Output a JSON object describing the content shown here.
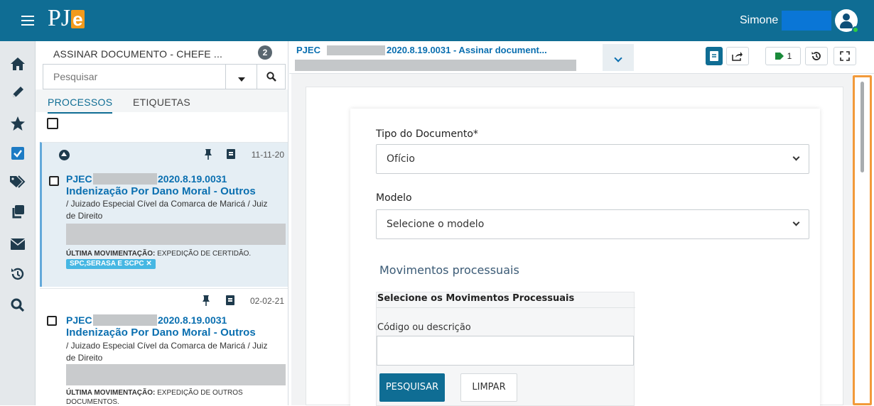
{
  "app": {
    "logo": "PJ",
    "logo_e": "e"
  },
  "user": {
    "name": "Simone"
  },
  "sidebar": {
    "icons": [
      "home-icon",
      "pencil-icon",
      "star-icon",
      "checkbox-icon",
      "tags-icon",
      "copy-icon",
      "envelope-icon",
      "history-icon",
      "search-icon"
    ]
  },
  "tasks": {
    "title": "ASSINAR DOCUMENTO - CHEFE ...",
    "count": "2",
    "search_placeholder": "Pesquisar",
    "tabs": [
      "PROCESSOS",
      "ETIQUETAS"
    ]
  },
  "cards": [
    {
      "date": "11-11-20",
      "num_prefix": "PJEC",
      "num_suffix": "2020.8.19.0031",
      "classe": "Indenização Por Dano Moral - Outros",
      "orgao": "/ Juizado Especial Cível da Comarca de Maricá / Juiz de Direito",
      "mov_label": "ÚLTIMA MOVIMENTAÇÃO:",
      "mov_text": "EXPEDIÇÃO DE CERTIDÃO.",
      "tag": "SPC,SERASA E SCPC ✕"
    },
    {
      "date": "02-02-21",
      "num_prefix": "PJEC",
      "num_suffix": "2020.8.19.0031",
      "classe": "Indenização Por Dano Moral - Outros",
      "orgao": "/ Juizado Especial Cível da Comarca de Maricá / Juiz de Direito",
      "mov_label": "ÚLTIMA MOVIMENTAÇÃO:",
      "mov_text": "EXPEDIÇÃO DE OUTROS DOCUMENTOS."
    }
  ],
  "detail": {
    "proc_prefix": "PJEC",
    "proc_title": "2020.8.19.0031 - Assinar document...",
    "tag_count": "1"
  },
  "form": {
    "tipo_label": "Tipo do Documento*",
    "tipo_value": "Ofício",
    "modelo_label": "Modelo",
    "modelo_value": "Selecione o modelo",
    "section": "Movimentos processuais",
    "mov_header": "Selecione os Movimentos Processuais",
    "mov_field_label": "Código ou descrição",
    "btn_pesquisar": "PESQUISAR",
    "btn_limpar": "LIMPAR"
  },
  "colors": {
    "brand": "#0f6d94",
    "link": "#0a6fb0",
    "tag": "#46b7e3",
    "highlight": "#f29a3a"
  }
}
